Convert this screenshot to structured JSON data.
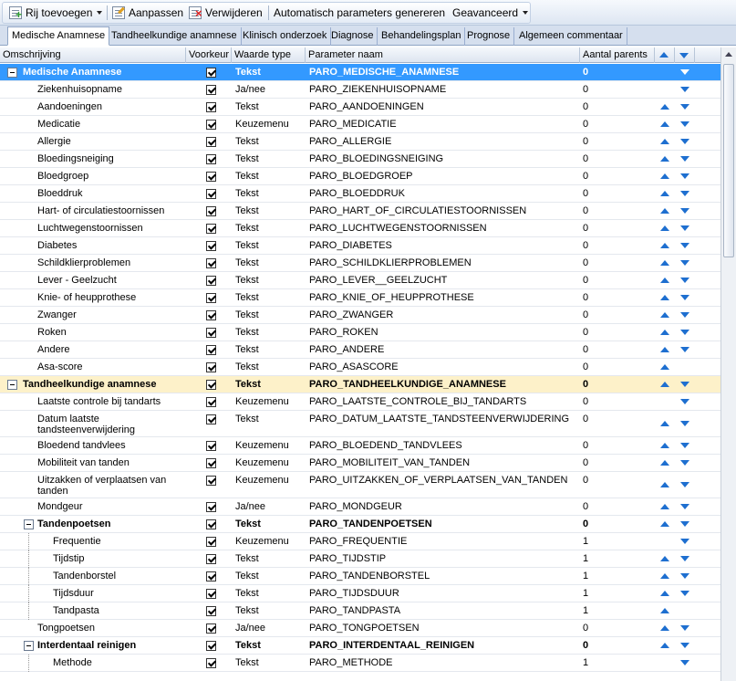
{
  "toolbar": {
    "add_label": "Rij toevoegen",
    "edit_label": "Aanpassen",
    "delete_label": "Verwijderen",
    "generate_label": "Automatisch parameters genereren",
    "advanced_label": "Geavanceerd"
  },
  "tabs": [
    "Medische Anamnese",
    "Tandheelkundige anamnese",
    "Klinisch onderzoek",
    "Diagnose",
    "Behandelingsplan",
    "Prognose",
    "Algemeen commentaar"
  ],
  "columns": {
    "description": "Omschrijving",
    "preference": "Voorkeur",
    "value_type": "Waarde type",
    "parameter_name": "Parameter naam",
    "parent_count": "Aantal parents"
  },
  "rows": [
    {
      "level": 0,
      "group": true,
      "desc": "Medische Anamnese",
      "type": "Tekst",
      "param": "PARO_MEDISCHE_ANAMNESE",
      "parents": "0",
      "up": false,
      "down": true,
      "selected": true
    },
    {
      "level": 1,
      "desc": "Ziekenhuisopname",
      "type": "Ja/nee",
      "param": "PARO_ZIEKENHUISOPNAME",
      "parents": "0",
      "up": false,
      "down": true
    },
    {
      "level": 1,
      "desc": "Aandoeningen",
      "type": "Tekst",
      "param": "PARO_AANDOENINGEN",
      "parents": "0",
      "up": true,
      "down": true
    },
    {
      "level": 1,
      "desc": "Medicatie",
      "type": "Keuzemenu",
      "param": "PARO_MEDICATIE",
      "parents": "0",
      "up": true,
      "down": true
    },
    {
      "level": 1,
      "desc": "Allergie",
      "type": "Tekst",
      "param": "PARO_ALLERGIE",
      "parents": "0",
      "up": true,
      "down": true
    },
    {
      "level": 1,
      "desc": "Bloedingsneiging",
      "type": "Tekst",
      "param": "PARO_BLOEDINGSNEIGING",
      "parents": "0",
      "up": true,
      "down": true
    },
    {
      "level": 1,
      "desc": "Bloedgroep",
      "type": "Tekst",
      "param": "PARO_BLOEDGROEP",
      "parents": "0",
      "up": true,
      "down": true
    },
    {
      "level": 1,
      "desc": "Bloeddruk",
      "type": "Tekst",
      "param": "PARO_BLOEDDRUK",
      "parents": "0",
      "up": true,
      "down": true
    },
    {
      "level": 1,
      "desc": "Hart- of circulatiestoornissen",
      "type": "Tekst",
      "param": "PARO_HART_OF_CIRCULATIESTOORNISSEN",
      "parents": "0",
      "up": true,
      "down": true
    },
    {
      "level": 1,
      "desc": "Luchtwegenstoornissen",
      "type": "Tekst",
      "param": "PARO_LUCHTWEGENSTOORNISSEN",
      "parents": "0",
      "up": true,
      "down": true
    },
    {
      "level": 1,
      "desc": "Diabetes",
      "type": "Tekst",
      "param": "PARO_DIABETES",
      "parents": "0",
      "up": true,
      "down": true
    },
    {
      "level": 1,
      "desc": "Schildklierproblemen",
      "type": "Tekst",
      "param": "PARO_SCHILDKLIERPROBLEMEN",
      "parents": "0",
      "up": true,
      "down": true
    },
    {
      "level": 1,
      "desc": "Lever - Geelzucht",
      "type": "Tekst",
      "param": "PARO_LEVER__GEELZUCHT",
      "parents": "0",
      "up": true,
      "down": true
    },
    {
      "level": 1,
      "desc": "Knie- of heupprothese",
      "type": "Tekst",
      "param": "PARO_KNIE_OF_HEUPPROTHESE",
      "parents": "0",
      "up": true,
      "down": true
    },
    {
      "level": 1,
      "desc": "Zwanger",
      "type": "Tekst",
      "param": "PARO_ZWANGER",
      "parents": "0",
      "up": true,
      "down": true
    },
    {
      "level": 1,
      "desc": "Roken",
      "type": "Tekst",
      "param": "PARO_ROKEN",
      "parents": "0",
      "up": true,
      "down": true
    },
    {
      "level": 1,
      "desc": "Andere",
      "type": "Tekst",
      "param": "PARO_ANDERE",
      "parents": "0",
      "up": true,
      "down": true
    },
    {
      "level": 1,
      "desc": "Asa-score",
      "type": "Tekst",
      "param": "PARO_ASASCORE",
      "parents": "0",
      "up": true,
      "down": false
    },
    {
      "level": 0,
      "group": true,
      "desc": "Tandheelkundige anamnese",
      "type": "Tekst",
      "param": "PARO_TANDHEELKUNDIGE_ANAMNESE",
      "parents": "0",
      "up": true,
      "down": true
    },
    {
      "level": 1,
      "desc": "Laatste controle bij tandarts",
      "type": "Keuzemenu",
      "param": "PARO_LAATSTE_CONTROLE_BIJ_TANDARTS",
      "parents": "0",
      "up": false,
      "down": true
    },
    {
      "level": 1,
      "tall": true,
      "desc": "Datum laatste tandsteenverwijdering",
      "type": "Tekst",
      "param": "PARO_DATUM_LAATSTE_TANDSTEENVERWIJDERING",
      "parents": "0",
      "up": true,
      "down": true
    },
    {
      "level": 1,
      "desc": "Bloedend tandvlees",
      "type": "Keuzemenu",
      "param": "PARO_BLOEDEND_TANDVLEES",
      "parents": "0",
      "up": true,
      "down": true
    },
    {
      "level": 1,
      "desc": "Mobiliteit van tanden",
      "type": "Keuzemenu",
      "param": "PARO_MOBILITEIT_VAN_TANDEN",
      "parents": "0",
      "up": true,
      "down": true
    },
    {
      "level": 1,
      "tall": true,
      "desc": "Uitzakken of verplaatsen van tanden",
      "type": "Keuzemenu",
      "param": "PARO_UITZAKKEN_OF_VERPLAATSEN_VAN_TANDEN",
      "parents": "0",
      "up": true,
      "down": true
    },
    {
      "level": 1,
      "desc": "Mondgeur",
      "type": "Ja/nee",
      "param": "PARO_MONDGEUR",
      "parents": "0",
      "up": true,
      "down": true
    },
    {
      "level": 1,
      "group": true,
      "sub": true,
      "desc": "Tandenpoetsen",
      "type": "Tekst",
      "param": "PARO_TANDENPOETSEN",
      "parents": "0",
      "up": true,
      "down": true
    },
    {
      "level": 2,
      "desc": "Frequentie",
      "type": "Keuzemenu",
      "param": "PARO_FREQUENTIE",
      "parents": "1",
      "up": false,
      "down": true
    },
    {
      "level": 2,
      "desc": "Tijdstip",
      "type": "Tekst",
      "param": "PARO_TIJDSTIP",
      "parents": "1",
      "up": true,
      "down": true
    },
    {
      "level": 2,
      "desc": "Tandenborstel",
      "type": "Tekst",
      "param": "PARO_TANDENBORSTEL",
      "parents": "1",
      "up": true,
      "down": true
    },
    {
      "level": 2,
      "desc": "Tijdsduur",
      "type": "Tekst",
      "param": "PARO_TIJDSDUUR",
      "parents": "1",
      "up": true,
      "down": true
    },
    {
      "level": 2,
      "desc": "Tandpasta",
      "type": "Tekst",
      "param": "PARO_TANDPASTA",
      "parents": "1",
      "up": true,
      "down": false
    },
    {
      "level": 1,
      "desc": "Tongpoetsen",
      "type": "Ja/nee",
      "param": "PARO_TONGPOETSEN",
      "parents": "0",
      "up": true,
      "down": true
    },
    {
      "level": 1,
      "group": true,
      "sub": true,
      "desc": "Interdentaal reinigen",
      "type": "Tekst",
      "param": "PARO_INTERDENTAAL_REINIGEN",
      "parents": "0",
      "up": true,
      "down": true
    },
    {
      "level": 2,
      "desc": "Methode",
      "type": "Tekst",
      "param": "PARO_METHODE",
      "parents": "1",
      "up": false,
      "down": true
    }
  ]
}
